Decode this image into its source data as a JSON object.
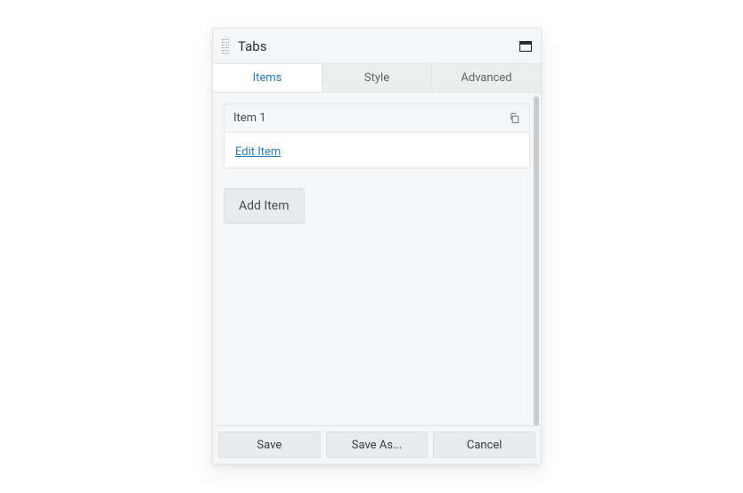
{
  "header": {
    "title": "Tabs"
  },
  "tabs": [
    {
      "label": "Items",
      "active": true
    },
    {
      "label": "Style",
      "active": false
    },
    {
      "label": "Advanced",
      "active": false
    }
  ],
  "items": [
    {
      "label": "Item 1",
      "edit_label": "Edit Item"
    }
  ],
  "buttons": {
    "add_item": "Add Item",
    "save": "Save",
    "save_as": "Save As...",
    "cancel": "Cancel"
  }
}
